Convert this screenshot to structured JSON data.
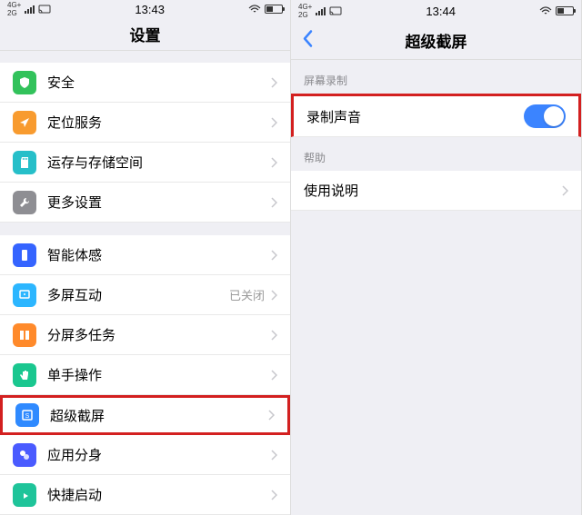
{
  "left": {
    "status": {
      "net1": "4G+",
      "net2": "2G",
      "time": "13:43"
    },
    "title": "设置",
    "group1": [
      {
        "label": "安全",
        "icon_color": "#32c25b",
        "glyph": "shield"
      },
      {
        "label": "定位服务",
        "icon_color": "#f89b2f",
        "glyph": "location"
      },
      {
        "label": "运存与存储空间",
        "icon_color": "#26bfc9",
        "glyph": "sd"
      },
      {
        "label": "更多设置",
        "icon_color": "#8e8e93",
        "glyph": "wrench"
      }
    ],
    "group2": [
      {
        "label": "智能体感",
        "icon_color": "#3564ff",
        "glyph": "phone"
      },
      {
        "label": "多屏互动",
        "icon_color": "#2cb6ff",
        "glyph": "cast",
        "value": "已关闭"
      },
      {
        "label": "分屏多任务",
        "icon_color": "#ff8a2b",
        "glyph": "split"
      },
      {
        "label": "单手操作",
        "icon_color": "#1ac78f",
        "glyph": "hand"
      },
      {
        "label": "超级截屏",
        "icon_color": "#2f8aff",
        "glyph": "screenshot",
        "highlight": true
      },
      {
        "label": "应用分身",
        "icon_color": "#4a5bff",
        "glyph": "clone"
      },
      {
        "label": "快捷启动",
        "icon_color": "#1fc49a",
        "glyph": "launch"
      }
    ]
  },
  "right": {
    "status": {
      "net1": "4G+",
      "net2": "2G",
      "time": "13:44"
    },
    "title": "超级截屏",
    "section1_header": "屏幕录制",
    "section1": [
      {
        "label": "录制声音",
        "toggle": true,
        "highlight": true
      }
    ],
    "section2_header": "帮助",
    "section2": [
      {
        "label": "使用说明"
      }
    ]
  }
}
